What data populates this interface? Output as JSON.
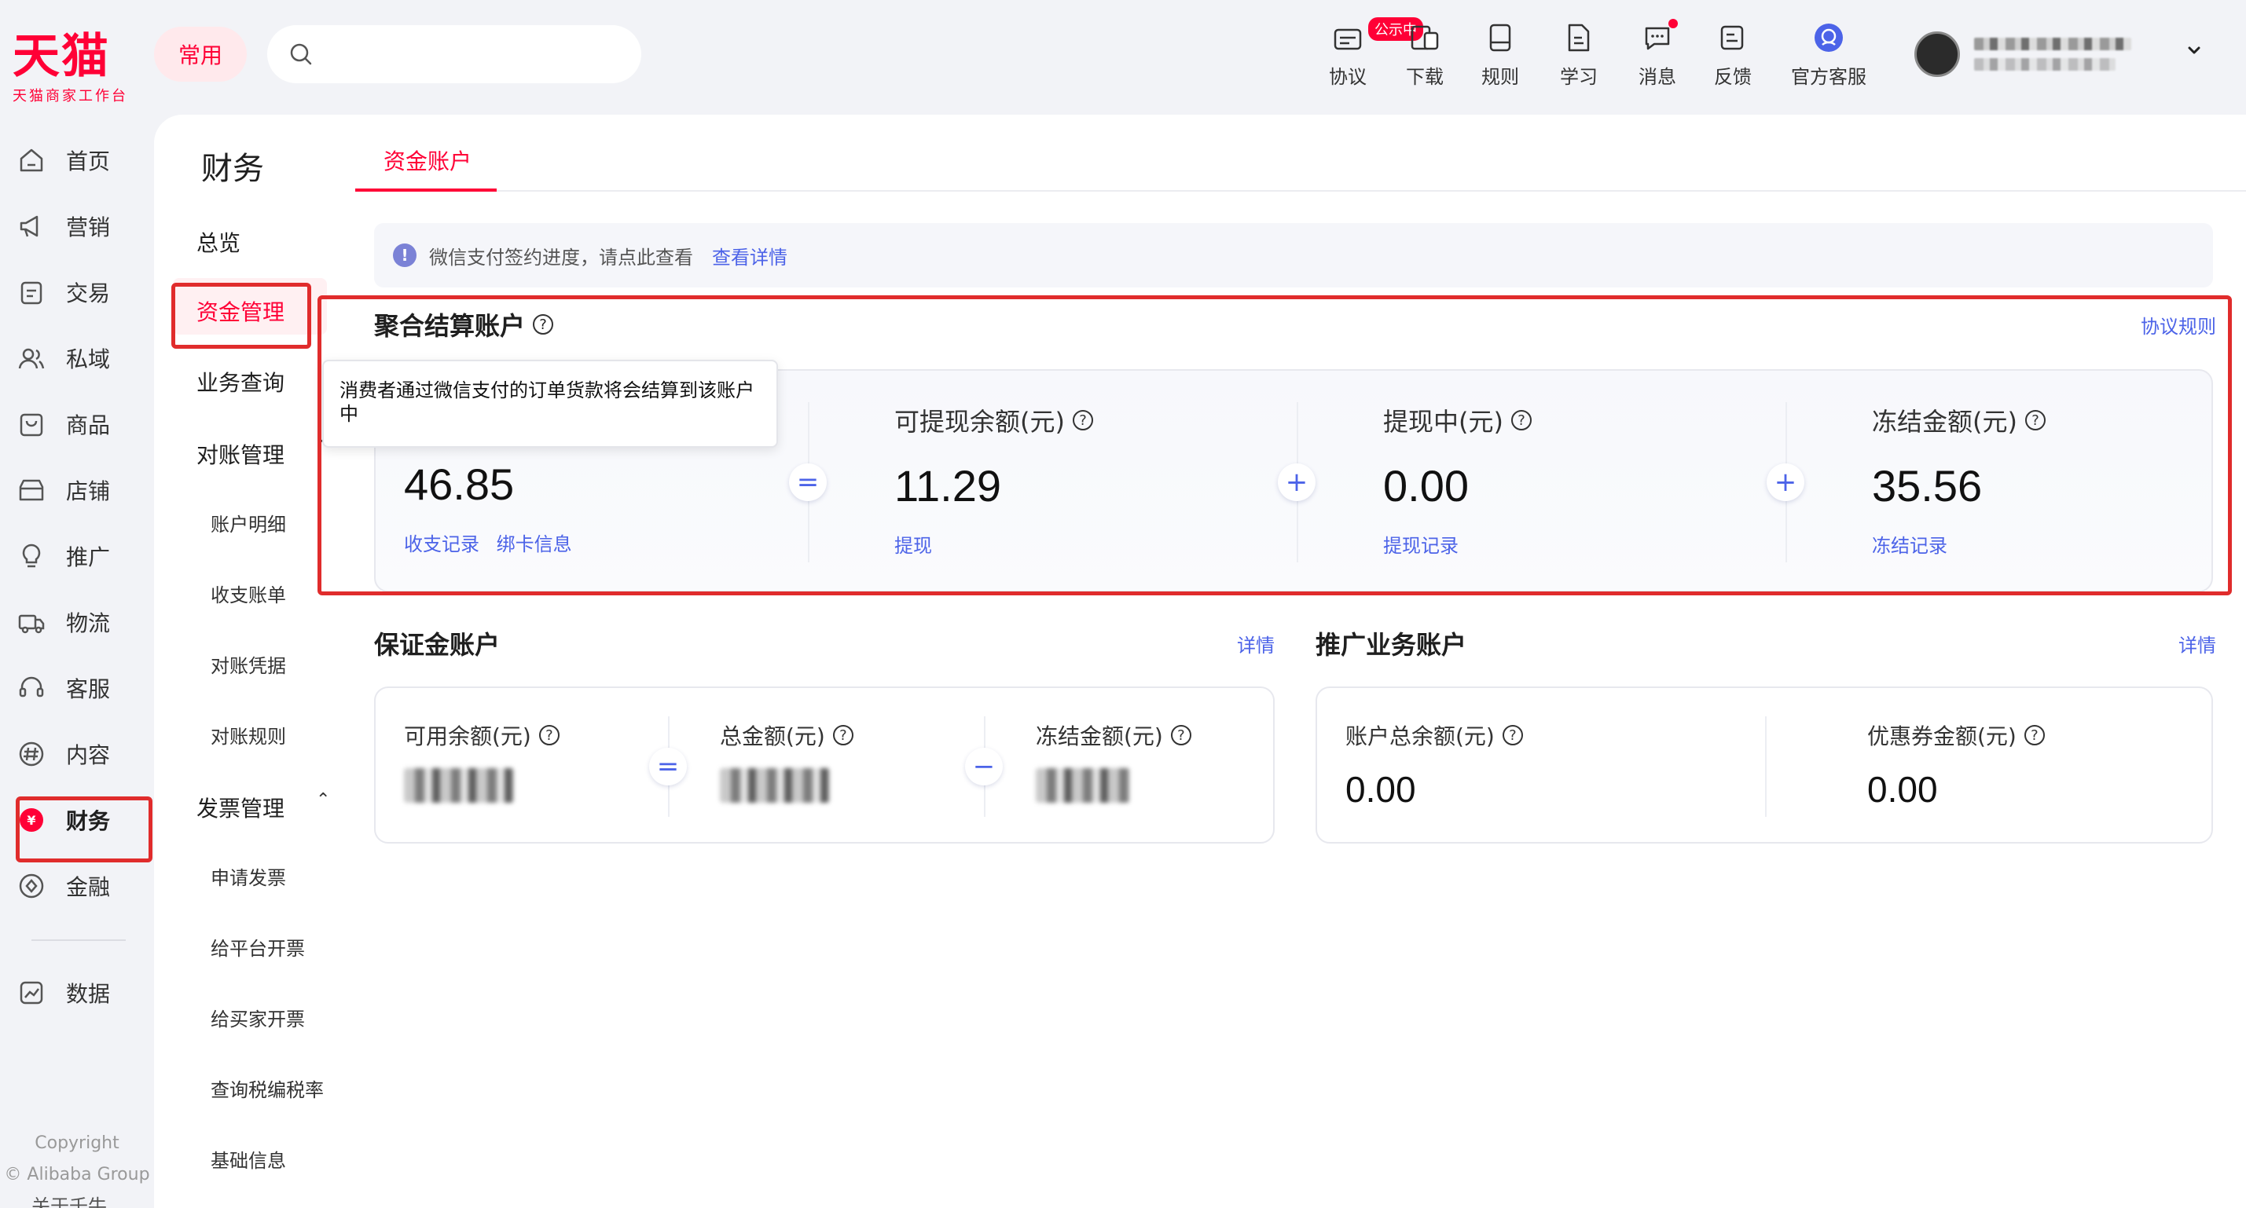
{
  "brand": {
    "name": "天猫",
    "subtitle": "天猫商家工作台",
    "color": "#ff0036"
  },
  "header": {
    "common_label": "常用",
    "search": {
      "placeholder": ""
    },
    "tools": [
      {
        "label": "协议",
        "icon": "agreement-icon",
        "badge": "公示中"
      },
      {
        "label": "下载",
        "icon": "download-icon"
      },
      {
        "label": "规则",
        "icon": "rules-icon"
      },
      {
        "label": "学习",
        "icon": "learn-icon"
      },
      {
        "label": "消息",
        "icon": "message-icon",
        "dot": true
      },
      {
        "label": "反馈",
        "icon": "feedback-icon"
      },
      {
        "label": "官方客服",
        "icon": "customer-service-icon"
      }
    ]
  },
  "sidebar": {
    "items": [
      {
        "label": "首页",
        "icon": "home-icon"
      },
      {
        "label": "营销",
        "icon": "megaphone-icon"
      },
      {
        "label": "交易",
        "icon": "trade-icon"
      },
      {
        "label": "私域",
        "icon": "private-domain-icon"
      },
      {
        "label": "商品",
        "icon": "goods-icon"
      },
      {
        "label": "店铺",
        "icon": "store-icon"
      },
      {
        "label": "推广",
        "icon": "promotion-icon"
      },
      {
        "label": "物流",
        "icon": "logistics-icon"
      },
      {
        "label": "客服",
        "icon": "headset-icon"
      },
      {
        "label": "内容",
        "icon": "content-icon"
      },
      {
        "label": "财务",
        "icon": "finance-icon",
        "active": true
      },
      {
        "label": "金融",
        "icon": "banking-icon"
      },
      {
        "label": "数据",
        "icon": "data-icon"
      }
    ],
    "about": "关于千牛",
    "copyright_1": "Copyright",
    "copyright_2": "© Alibaba Group"
  },
  "subnav": {
    "title": "财务",
    "overview": "总览",
    "fund_mgmt": "资金管理",
    "business_query": "业务查询",
    "reconcile": "对账管理",
    "account_detail": "账户明细",
    "income_bill": "收支账单",
    "reconcile_voucher": "对账凭据",
    "reconcile_rules": "对账规则",
    "invoice_mgmt": "发票管理",
    "apply_invoice": "申请发票",
    "invoice_platform": "给平台开票",
    "invoice_buyer": "给买家开票",
    "tax_rate": "查询税编税率",
    "basic_info": "基础信息"
  },
  "tabs": {
    "active": "资金账户"
  },
  "notice": {
    "text": "微信支付签约进度，请点此查看",
    "link": "查看详情"
  },
  "aggregate": {
    "title": "聚合结算账户",
    "rules_link": "协议规则",
    "tooltip": "消费者通过微信支付的订单货款将会结算到该账户中",
    "total_value": "46.85",
    "total_link_1": "收支记录",
    "total_link_2": "绑卡信息",
    "withdrawable_label": "可提现余额(元)",
    "withdrawable_value": "11.29",
    "withdrawable_link": "提现",
    "withdrawing_label": "提现中(元)",
    "withdrawing_value": "0.00",
    "withdrawing_link": "提现记录",
    "frozen_label": "冻结金额(元)",
    "frozen_value": "35.56",
    "frozen_link": "冻结记录",
    "op_equals": "=",
    "op_plus": "+"
  },
  "deposit": {
    "title": "保证金账户",
    "detail_link": "详情",
    "available_label": "可用余额(元)",
    "total_label": "总金额(元)",
    "frozen_label": "冻结金额(元)",
    "op_equals": "=",
    "op_minus": "−"
  },
  "promo": {
    "title": "推广业务账户",
    "detail_link": "详情",
    "balance_label": "账户总余额(元)",
    "balance_value": "0.00",
    "coupon_label": "优惠券金额(元)",
    "coupon_value": "0.00"
  },
  "colors": {
    "accent": "#ff0036",
    "link": "#4c63e8",
    "annotation": "#e02c2c"
  }
}
